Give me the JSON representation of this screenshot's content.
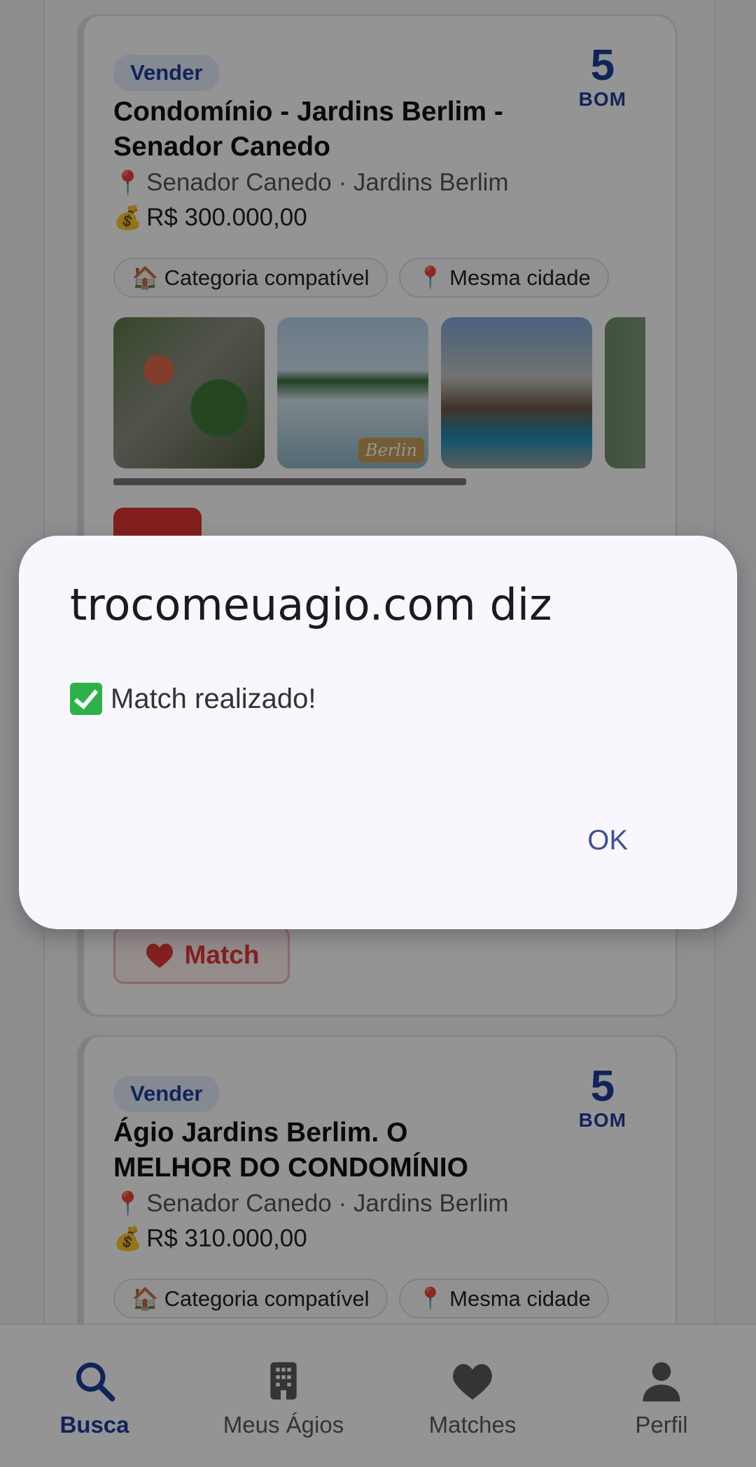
{
  "listings": [
    {
      "type_badge": "Vender",
      "score": "5",
      "score_label": "BOM",
      "title": "Condomínio - Jardins Berlim - Senador Canedo",
      "location_icon": "📍",
      "location": "Senador Canedo · Jardins Berlim",
      "price_icon": "💰",
      "price": "R$ 300.000,00",
      "chips": [
        {
          "icon": "🏠",
          "label": "Categoria compatível"
        },
        {
          "icon": "📍",
          "label": "Mesma cidade"
        }
      ],
      "gallery_watermark": "Berlin",
      "match_label": "Match"
    },
    {
      "type_badge": "Vender",
      "score": "5",
      "score_label": "BOM",
      "title": "Ágio Jardins Berlim. O MELHOR DO CONDOMÍNIO",
      "location_icon": "📍",
      "location": "Senador Canedo · Jardins Berlim",
      "price_icon": "💰",
      "price": "R$ 310.000,00",
      "chips": [
        {
          "icon": "🏠",
          "label": "Categoria compatível"
        },
        {
          "icon": "📍",
          "label": "Mesma cidade"
        }
      ]
    }
  ],
  "dialog": {
    "title": "trocomeuagio.com diz",
    "message": "Match realizado!",
    "ok_label": "OK"
  },
  "nav": {
    "items": [
      {
        "label": "Busca",
        "icon": "search-icon"
      },
      {
        "label": "Meus Ágios",
        "icon": "building-icon"
      },
      {
        "label": "Matches",
        "icon": "heart-icon"
      },
      {
        "label": "Perfil",
        "icon": "person-icon"
      }
    ]
  },
  "colors": {
    "accent": "#1d3f9c",
    "match_red": "#e23a3a",
    "dialog_button": "#40518f"
  }
}
